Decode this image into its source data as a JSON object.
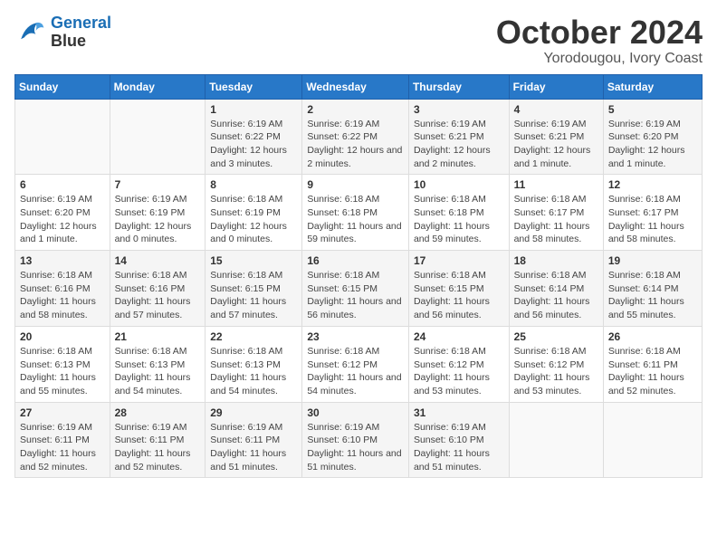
{
  "logo": {
    "line1": "General",
    "line2": "Blue"
  },
  "title": "October 2024",
  "subtitle": "Yorodougou, Ivory Coast",
  "weekdays": [
    "Sunday",
    "Monday",
    "Tuesday",
    "Wednesday",
    "Thursday",
    "Friday",
    "Saturday"
  ],
  "weeks": [
    [
      {
        "day": "",
        "info": ""
      },
      {
        "day": "",
        "info": ""
      },
      {
        "day": "1",
        "info": "Sunrise: 6:19 AM\nSunset: 6:22 PM\nDaylight: 12 hours and 3 minutes."
      },
      {
        "day": "2",
        "info": "Sunrise: 6:19 AM\nSunset: 6:22 PM\nDaylight: 12 hours and 2 minutes."
      },
      {
        "day": "3",
        "info": "Sunrise: 6:19 AM\nSunset: 6:21 PM\nDaylight: 12 hours and 2 minutes."
      },
      {
        "day": "4",
        "info": "Sunrise: 6:19 AM\nSunset: 6:21 PM\nDaylight: 12 hours and 1 minute."
      },
      {
        "day": "5",
        "info": "Sunrise: 6:19 AM\nSunset: 6:20 PM\nDaylight: 12 hours and 1 minute."
      }
    ],
    [
      {
        "day": "6",
        "info": "Sunrise: 6:19 AM\nSunset: 6:20 PM\nDaylight: 12 hours and 1 minute."
      },
      {
        "day": "7",
        "info": "Sunrise: 6:19 AM\nSunset: 6:19 PM\nDaylight: 12 hours and 0 minutes."
      },
      {
        "day": "8",
        "info": "Sunrise: 6:18 AM\nSunset: 6:19 PM\nDaylight: 12 hours and 0 minutes."
      },
      {
        "day": "9",
        "info": "Sunrise: 6:18 AM\nSunset: 6:18 PM\nDaylight: 11 hours and 59 minutes."
      },
      {
        "day": "10",
        "info": "Sunrise: 6:18 AM\nSunset: 6:18 PM\nDaylight: 11 hours and 59 minutes."
      },
      {
        "day": "11",
        "info": "Sunrise: 6:18 AM\nSunset: 6:17 PM\nDaylight: 11 hours and 58 minutes."
      },
      {
        "day": "12",
        "info": "Sunrise: 6:18 AM\nSunset: 6:17 PM\nDaylight: 11 hours and 58 minutes."
      }
    ],
    [
      {
        "day": "13",
        "info": "Sunrise: 6:18 AM\nSunset: 6:16 PM\nDaylight: 11 hours and 58 minutes."
      },
      {
        "day": "14",
        "info": "Sunrise: 6:18 AM\nSunset: 6:16 PM\nDaylight: 11 hours and 57 minutes."
      },
      {
        "day": "15",
        "info": "Sunrise: 6:18 AM\nSunset: 6:15 PM\nDaylight: 11 hours and 57 minutes."
      },
      {
        "day": "16",
        "info": "Sunrise: 6:18 AM\nSunset: 6:15 PM\nDaylight: 11 hours and 56 minutes."
      },
      {
        "day": "17",
        "info": "Sunrise: 6:18 AM\nSunset: 6:15 PM\nDaylight: 11 hours and 56 minutes."
      },
      {
        "day": "18",
        "info": "Sunrise: 6:18 AM\nSunset: 6:14 PM\nDaylight: 11 hours and 56 minutes."
      },
      {
        "day": "19",
        "info": "Sunrise: 6:18 AM\nSunset: 6:14 PM\nDaylight: 11 hours and 55 minutes."
      }
    ],
    [
      {
        "day": "20",
        "info": "Sunrise: 6:18 AM\nSunset: 6:13 PM\nDaylight: 11 hours and 55 minutes."
      },
      {
        "day": "21",
        "info": "Sunrise: 6:18 AM\nSunset: 6:13 PM\nDaylight: 11 hours and 54 minutes."
      },
      {
        "day": "22",
        "info": "Sunrise: 6:18 AM\nSunset: 6:13 PM\nDaylight: 11 hours and 54 minutes."
      },
      {
        "day": "23",
        "info": "Sunrise: 6:18 AM\nSunset: 6:12 PM\nDaylight: 11 hours and 54 minutes."
      },
      {
        "day": "24",
        "info": "Sunrise: 6:18 AM\nSunset: 6:12 PM\nDaylight: 11 hours and 53 minutes."
      },
      {
        "day": "25",
        "info": "Sunrise: 6:18 AM\nSunset: 6:12 PM\nDaylight: 11 hours and 53 minutes."
      },
      {
        "day": "26",
        "info": "Sunrise: 6:18 AM\nSunset: 6:11 PM\nDaylight: 11 hours and 52 minutes."
      }
    ],
    [
      {
        "day": "27",
        "info": "Sunrise: 6:19 AM\nSunset: 6:11 PM\nDaylight: 11 hours and 52 minutes."
      },
      {
        "day": "28",
        "info": "Sunrise: 6:19 AM\nSunset: 6:11 PM\nDaylight: 11 hours and 52 minutes."
      },
      {
        "day": "29",
        "info": "Sunrise: 6:19 AM\nSunset: 6:11 PM\nDaylight: 11 hours and 51 minutes."
      },
      {
        "day": "30",
        "info": "Sunrise: 6:19 AM\nSunset: 6:10 PM\nDaylight: 11 hours and 51 minutes."
      },
      {
        "day": "31",
        "info": "Sunrise: 6:19 AM\nSunset: 6:10 PM\nDaylight: 11 hours and 51 minutes."
      },
      {
        "day": "",
        "info": ""
      },
      {
        "day": "",
        "info": ""
      }
    ]
  ]
}
